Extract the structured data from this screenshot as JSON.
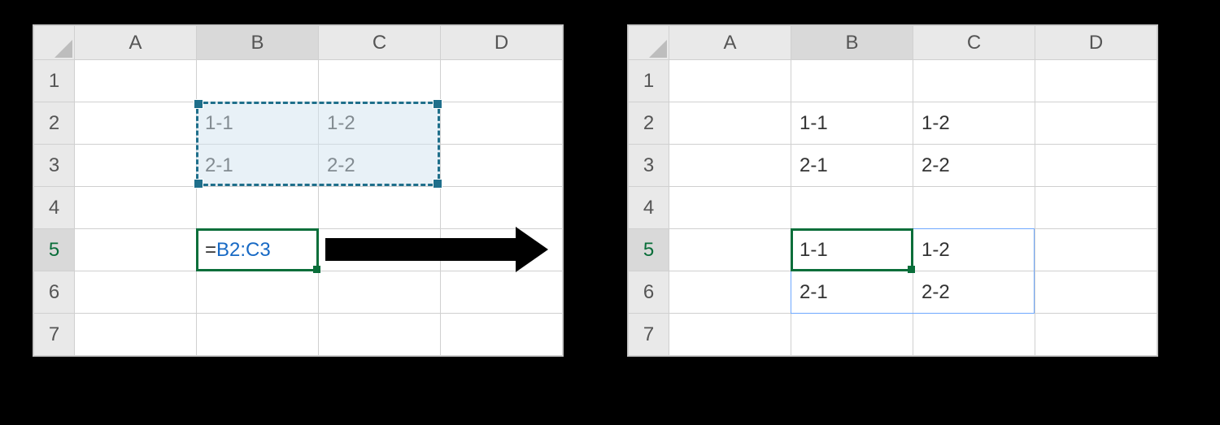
{
  "columns": [
    "A",
    "B",
    "C",
    "D"
  ],
  "rows": [
    "1",
    "2",
    "3",
    "4",
    "5",
    "6",
    "7"
  ],
  "left": {
    "cells": {
      "B2": "1-1",
      "C2": "1-2",
      "B3": "2-1",
      "C3": "2-2"
    },
    "active_row_header": "5",
    "active_col_header": "B",
    "formula": {
      "prefix": "=",
      "ref": "B2:C3"
    },
    "selection_range": "B2:C3",
    "editing_cell": "B5"
  },
  "right": {
    "cells": {
      "B2": "1-1",
      "C2": "1-2",
      "B3": "2-1",
      "C3": "2-2",
      "B5": "1-1",
      "C5": "1-2",
      "B6": "2-1",
      "C6": "2-2"
    },
    "active_cell": "B5",
    "spill_range": "B5:C6"
  }
}
